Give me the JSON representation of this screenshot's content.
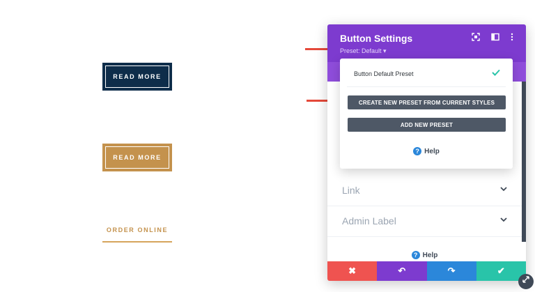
{
  "preview": {
    "dark_button_label": "READ MORE",
    "gold_button_label": "READ MORE",
    "link_button_label": "ORDER ONLINE"
  },
  "panel": {
    "title": "Button Settings",
    "preset": "Preset: Default ▾",
    "rows": [
      {
        "label": "Link"
      },
      {
        "label": "Admin Label"
      }
    ],
    "help_label": "Help",
    "footer": {
      "cancel_icon": "✖",
      "undo_icon": "↶",
      "redo_icon": "↷",
      "save_icon": "✔"
    }
  },
  "preset_dropdown": {
    "current_preset": "Button Default Preset",
    "create_preset_label": "CREATE NEW PRESET FROM CURRENT STYLES",
    "add_preset_label": "ADD NEW PRESET",
    "help_label": "Help"
  },
  "colors": {
    "header": "#7d3bcf",
    "cancel": "#ef5350",
    "undo": "#7d3bcf",
    "redo": "#2b87da",
    "save": "#29c4a9",
    "arrow": "#e5493a"
  },
  "icons": [
    "expand-icon",
    "columns-icon",
    "more-vertical-icon",
    "check-icon",
    "help-icon",
    "chevron-down-icon",
    "resize-handle-icon"
  ]
}
